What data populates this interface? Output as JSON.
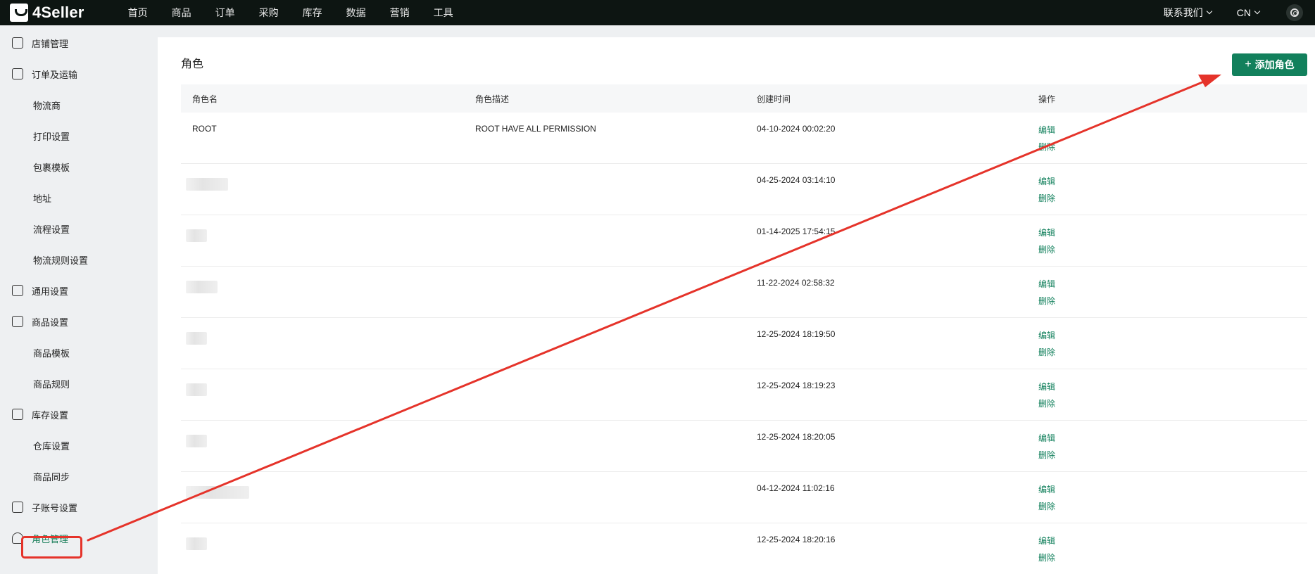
{
  "app": {
    "logo_text": "4Seller"
  },
  "topnav": {
    "items": [
      "首页",
      "商品",
      "订单",
      "采购",
      "库存",
      "数据",
      "营销",
      "工具"
    ],
    "contact_label": "联系我们",
    "lang_label": "CN"
  },
  "sidebar": {
    "items": [
      {
        "label": "店铺管理",
        "type": "group"
      },
      {
        "label": "订单及运输",
        "type": "group"
      },
      {
        "label": "物流商",
        "type": "sub"
      },
      {
        "label": "打印设置",
        "type": "sub"
      },
      {
        "label": "包裹模板",
        "type": "sub"
      },
      {
        "label": "地址",
        "type": "sub"
      },
      {
        "label": "流程设置",
        "type": "sub"
      },
      {
        "label": "物流规则设置",
        "type": "sub"
      },
      {
        "label": "通用设置",
        "type": "group"
      },
      {
        "label": "商品设置",
        "type": "group"
      },
      {
        "label": "商品模板",
        "type": "sub"
      },
      {
        "label": "商品规则",
        "type": "sub"
      },
      {
        "label": "库存设置",
        "type": "group"
      },
      {
        "label": "仓库设置",
        "type": "sub"
      },
      {
        "label": "商品同步",
        "type": "sub"
      },
      {
        "label": "子账号设置",
        "type": "group"
      },
      {
        "label": "角色管理",
        "type": "group",
        "active": true
      }
    ]
  },
  "main": {
    "title": "角色",
    "add_button_label": "添加角色",
    "columns": [
      "角色名",
      "角色描述",
      "创建时间",
      "操作"
    ],
    "rows": [
      {
        "name": "ROOT",
        "desc": "ROOT HAVE ALL PERMISSION",
        "created": "04-10-2024 00:02:20"
      },
      {
        "name": "",
        "desc": "",
        "created": "04-25-2024 03:14:10"
      },
      {
        "name": "",
        "desc": "",
        "created": "01-14-2025 17:54:15"
      },
      {
        "name": "",
        "desc": "",
        "created": "11-22-2024 02:58:32"
      },
      {
        "name": "",
        "desc": "",
        "created": "12-25-2024 18:19:50"
      },
      {
        "name": "",
        "desc": "",
        "created": "12-25-2024 18:19:23"
      },
      {
        "name": "",
        "desc": "",
        "created": "12-25-2024 18:20:05"
      },
      {
        "name": "",
        "desc": "",
        "created": "04-12-2024 11:02:16"
      },
      {
        "name": "",
        "desc": "",
        "created": "12-25-2024 18:20:16"
      }
    ],
    "edit_label": "编辑",
    "delete_label": "删除"
  },
  "colors": {
    "accent": "#12805c",
    "topbar": "#0d1512",
    "annotation": "#e5332a"
  }
}
